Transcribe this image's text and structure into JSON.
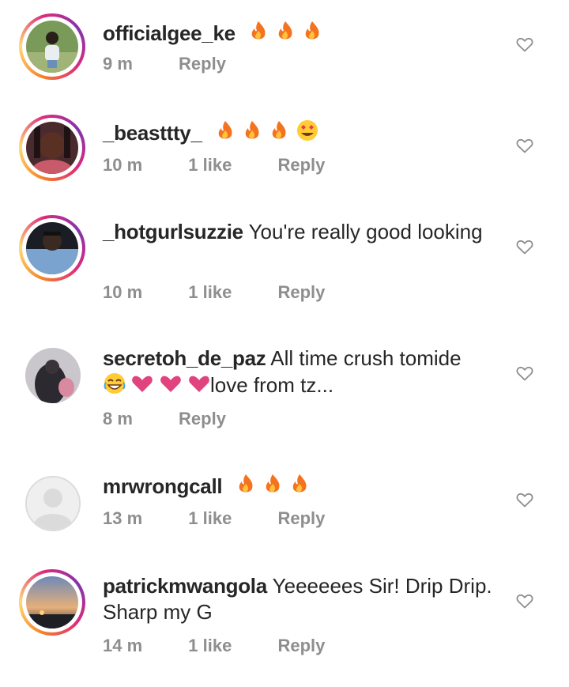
{
  "comments": [
    {
      "user": "officialgee_ke",
      "text": "",
      "emoji": "🔥🔥🔥",
      "time": "9 m",
      "likes": "",
      "reply": "Reply"
    },
    {
      "user": "_beasttty_",
      "text": "",
      "emoji": "🔥🔥🔥😍",
      "time": "10 m",
      "likes": "1 like",
      "reply": "Reply"
    },
    {
      "user": "_hotgurlsuzzie",
      "text": "You're really good looking",
      "emoji": "",
      "time": "10 m",
      "likes": "1 like",
      "reply": "Reply"
    },
    {
      "user": "secretoh_de_paz",
      "text": "All time crush tomide",
      "text2": "love from tz...",
      "emoji": "😂❤❤❤",
      "time": "8 m",
      "likes": "",
      "reply": "Reply"
    },
    {
      "user": "mrwrongcall",
      "text": "",
      "emoji": "🔥🔥🔥",
      "time": "13 m",
      "likes": "1 like",
      "reply": "Reply"
    },
    {
      "user": "patrickmwangola",
      "text": "Yeeeeees Sir! Drip Drip. Sharp my G",
      "emoji": "",
      "time": "14 m",
      "likes": "1 like",
      "reply": "Reply"
    }
  ],
  "icons": {
    "like": "heart-outline-icon",
    "avatar_placeholder": "default-avatar-icon"
  },
  "colors": {
    "meta": "#8e8e8e",
    "ring_start": "#f58529",
    "ring_end": "#dd2a7b"
  }
}
